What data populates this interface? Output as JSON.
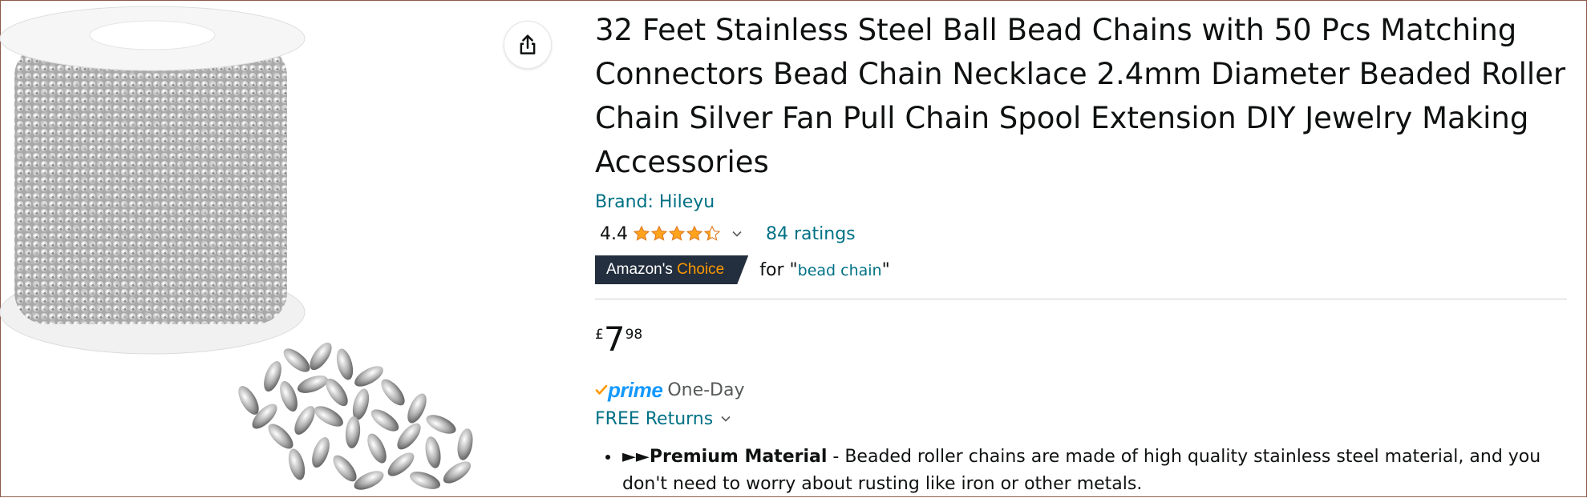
{
  "product": {
    "title": "32 Feet Stainless Steel Ball Bead Chains with 50 Pcs Matching Connectors Bead Chain Necklace 2.4mm Diameter Beaded Roller Chain Silver Fan Pull Chain Spool Extension DIY Jewelry Making Accessories",
    "brand_link": "Brand: Hileyu",
    "rating_value": "4.4",
    "rating_stars": 4.4,
    "ratings_count": "84 ratings",
    "choice_badge": {
      "part1": "Amazon's",
      "part2": "Choice"
    },
    "choice_for": {
      "prefix": "for \"",
      "keyword": "bead chain",
      "suffix": "\""
    },
    "price": {
      "currency": "£",
      "whole": "7",
      "fraction": "98"
    },
    "prime": {
      "label": "prime",
      "delivery": "One-Day"
    },
    "returns": "FREE Returns",
    "bullets": [
      {
        "prefix": "►►",
        "heading": "Premium Material",
        "text": " - Beaded roller chains are made of high quality stainless steel material, and you don't need to worry about rusting like iron or other metals."
      }
    ]
  },
  "icons": {
    "share": "share-icon",
    "star": "star-icon",
    "chevron": "chevron-down-icon",
    "check": "check-icon"
  },
  "colors": {
    "link": "#007185",
    "star": "#ffa41c",
    "badge_bg": "#232f3e",
    "badge_accent": "#ff9900",
    "prime": "#1399ff",
    "text": "#0f1111"
  }
}
